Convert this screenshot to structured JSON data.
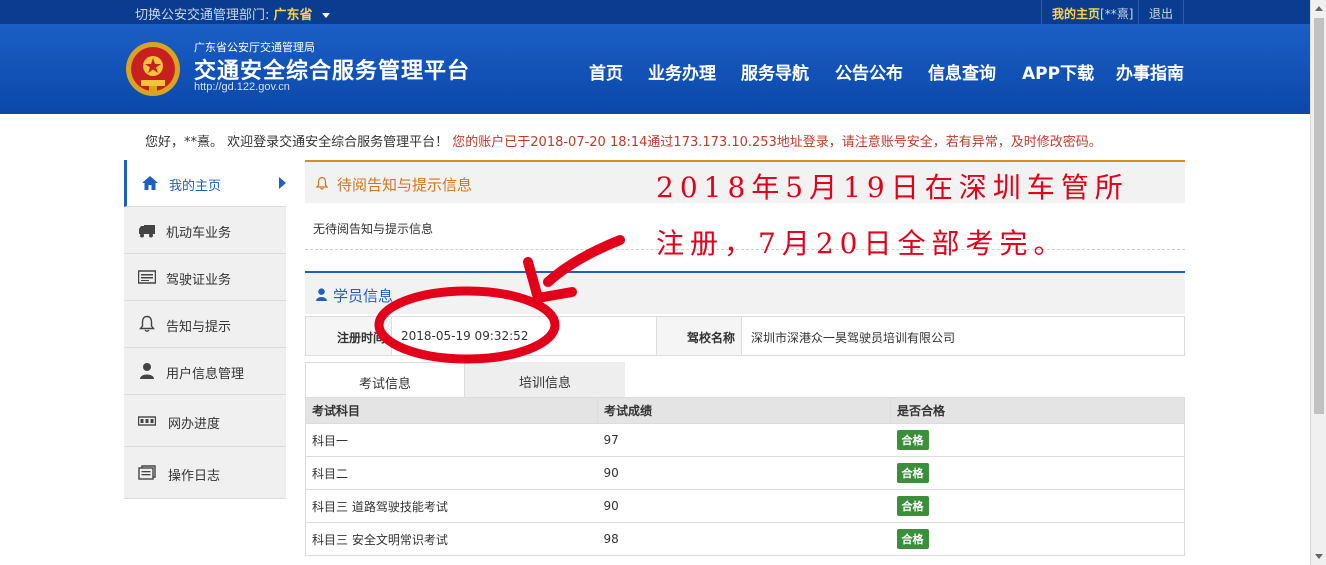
{
  "topbar": {
    "switch_label": "切换公安交通管理部门:",
    "province": "广东省",
    "my_home": "我的主页",
    "user_tag": "[**熹]",
    "logout": "退出"
  },
  "header": {
    "org": "广东省公安厅交通管理局",
    "site_name": "交通安全综合服务管理平台",
    "url": "http://gd.122.gov.cn",
    "nav": [
      "首页",
      "业务办理",
      "服务导航",
      "公告公布",
      "信息查询",
      "APP下载",
      "办事指南"
    ]
  },
  "welcome": {
    "greeting": "您好，**熹。 欢迎登录交通安全综合服务管理平台！",
    "warning": "您的账户已于2018-07-20 18:14通过173.173.10.253地址登录，请注意账号安全，若有异常，及时修改密码。"
  },
  "sidebar": {
    "items": [
      {
        "label": "我的主页",
        "icon": "home-icon"
      },
      {
        "label": "机动车业务",
        "icon": "truck-icon"
      },
      {
        "label": "驾驶证业务",
        "icon": "license-card-icon"
      },
      {
        "label": "告知与提示",
        "icon": "bell-icon"
      },
      {
        "label": "用户信息管理",
        "icon": "user-icon"
      },
      {
        "label": "网办进度",
        "icon": "progress-icon"
      },
      {
        "label": "操作日志",
        "icon": "log-icon"
      }
    ]
  },
  "notice": {
    "title": "待阅告知与提示信息",
    "empty_text": "无待阅告知与提示信息"
  },
  "student": {
    "title": "学员信息",
    "reg_time_label": "注册时间",
    "reg_time_value": "2018-05-19 09:32:52",
    "school_label": "驾校名称",
    "school_value": "深圳市深港众一昊驾驶员培训有限公司"
  },
  "tabs": [
    "考试信息",
    "培训信息"
  ],
  "exam_table": {
    "headers": [
      "考试科目",
      "考试成绩",
      "是否合格"
    ],
    "rows": [
      {
        "subject": "科目一",
        "score": "97",
        "result": "合格"
      },
      {
        "subject": "科目二",
        "score": "90",
        "result": "合格"
      },
      {
        "subject": "科目三 道路驾驶技能考试",
        "score": "90",
        "result": "合格"
      },
      {
        "subject": "科目三 安全文明常识考试",
        "score": "98",
        "result": "合格"
      }
    ]
  },
  "annotation": {
    "line1": "2018年5月19日在深圳车管所",
    "line2": "注册，7月20日全部考完。",
    "color": "#e3001b"
  },
  "colors": {
    "header_blue": "#0c47a9",
    "accent_blue": "#1f5fbf",
    "notice_orange": "#d4761a",
    "pass_green": "#3b8f3b"
  }
}
